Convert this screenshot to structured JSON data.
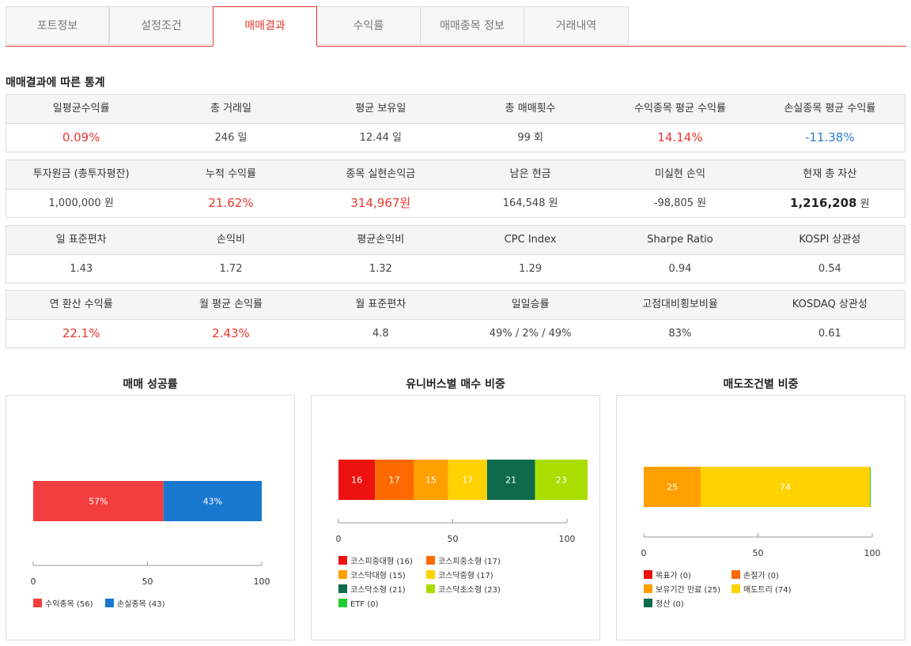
{
  "tabs": [
    {
      "label": "포트정보",
      "active": false
    },
    {
      "label": "설정조건",
      "active": false
    },
    {
      "label": "매매결과",
      "active": true
    },
    {
      "label": "수익률",
      "active": false
    },
    {
      "label": "매매종목 정보",
      "active": false
    },
    {
      "label": "거래내역",
      "active": false
    }
  ],
  "section_title": "매매결과에 따른 통계",
  "tables": [
    {
      "headers": [
        "일평균수익률",
        "총 거래일",
        "평균 보유일",
        "총 매매횟수",
        "수익종목 평균 수익률",
        "손실종목 평균 수익률"
      ],
      "values": [
        "0.09%",
        "246 일",
        "12.44 일",
        "99 회",
        "14.14%",
        "-11.38%"
      ],
      "styles": [
        "red",
        "",
        "",
        "",
        "red",
        "blue"
      ]
    },
    {
      "headers": [
        "투자원금 (총투자평잔)",
        "누적 수익률",
        "종목 실현손익금",
        "남은 현금",
        "미실현 손익",
        "현재 총 자산"
      ],
      "values": [
        "1,000,000 원",
        "21.62%",
        "314,967원",
        "164,548 원",
        "-98,805 원",
        "1,216,208"
      ],
      "styles": [
        "",
        "red",
        "red",
        "",
        "",
        "bold"
      ],
      "total_asset_unit": "원"
    },
    {
      "headers": [
        "일 표준편차",
        "손익비",
        "평균손익비",
        "CPC Index",
        "Sharpe Ratio",
        "KOSPI 상관성"
      ],
      "values": [
        "1.43",
        "1.72",
        "1.32",
        "1.29",
        "0.94",
        "0.54"
      ],
      "styles": [
        "",
        "",
        "",
        "",
        "",
        ""
      ]
    },
    {
      "headers": [
        "연 환산 수익률",
        "월 평균 손익률",
        "월 표준편차",
        "일일승률",
        "고점대비횡보비율",
        "KOSDAQ 상관성"
      ],
      "values": [
        "22.1%",
        "2.43%",
        "4.8",
        "49% / 2% / 49%",
        "83%",
        "0.61"
      ],
      "styles": [
        "red",
        "red",
        "",
        "",
        "",
        ""
      ]
    }
  ],
  "chart_data": [
    {
      "type": "bar",
      "orientation": "horizontal-stacked",
      "title": "매매 성공률",
      "series": [
        {
          "name": "수익종목",
          "value": 57,
          "label": "57%",
          "count": 56,
          "color": "#f23e3e"
        },
        {
          "name": "손실종목",
          "value": 43,
          "label": "43%",
          "count": 43,
          "color": "#1a78d0"
        }
      ],
      "xlim": [
        0,
        100
      ],
      "ticks": [
        "0",
        "50",
        "100"
      ],
      "legend": [
        "수익종목 (56)",
        "손실종목 (43)"
      ]
    },
    {
      "type": "bar",
      "orientation": "horizontal-stacked",
      "title": "유니버스별 매수 비중",
      "series": [
        {
          "name": "코스피중대형",
          "value": 16,
          "color": "#ee1111"
        },
        {
          "name": "코스피중소형",
          "value": 17,
          "color": "#ff6a00"
        },
        {
          "name": "코스닥대형",
          "value": 15,
          "color": "#ff9f00"
        },
        {
          "name": "코스닥중형",
          "value": 17,
          "color": "#ffd200"
        },
        {
          "name": "코스닥소형",
          "value": 21,
          "color": "#0f6b4c"
        },
        {
          "name": "코스닥초소형",
          "value": 23,
          "color": "#aadd00"
        },
        {
          "name": "ETF",
          "value": 0,
          "color": "#22cc33"
        }
      ],
      "xlim": [
        0,
        100
      ],
      "ticks": [
        "0",
        "50",
        "100"
      ],
      "legend": [
        "코스피중대형 (16)",
        "코스피중소형 (17)",
        "코스닥대형 (15)",
        "코스닥중형 (17)",
        "코스닥소형 (21)",
        "코스닥초소형 (23)",
        "ETF (0)"
      ]
    },
    {
      "type": "bar",
      "orientation": "horizontal-stacked",
      "title": "매도조건별 비중",
      "series": [
        {
          "name": "목표가",
          "value": 0,
          "color": "#ee1111"
        },
        {
          "name": "손절가",
          "value": 0,
          "color": "#ff6a00"
        },
        {
          "name": "보유기간 만료",
          "value": 25,
          "color": "#ff9f00"
        },
        {
          "name": "매도트리",
          "value": 74,
          "color": "#ffd200"
        },
        {
          "name": "청산",
          "value": 0,
          "color": "#0f6b4c"
        }
      ],
      "xlim": [
        0,
        100
      ],
      "ticks": [
        "0",
        "50",
        "100"
      ],
      "legend": [
        "목표가 (0)",
        "손절가 (0)",
        "보유기간 만료 (25)",
        "매도트리 (74)",
        "청산 (0)"
      ]
    }
  ]
}
